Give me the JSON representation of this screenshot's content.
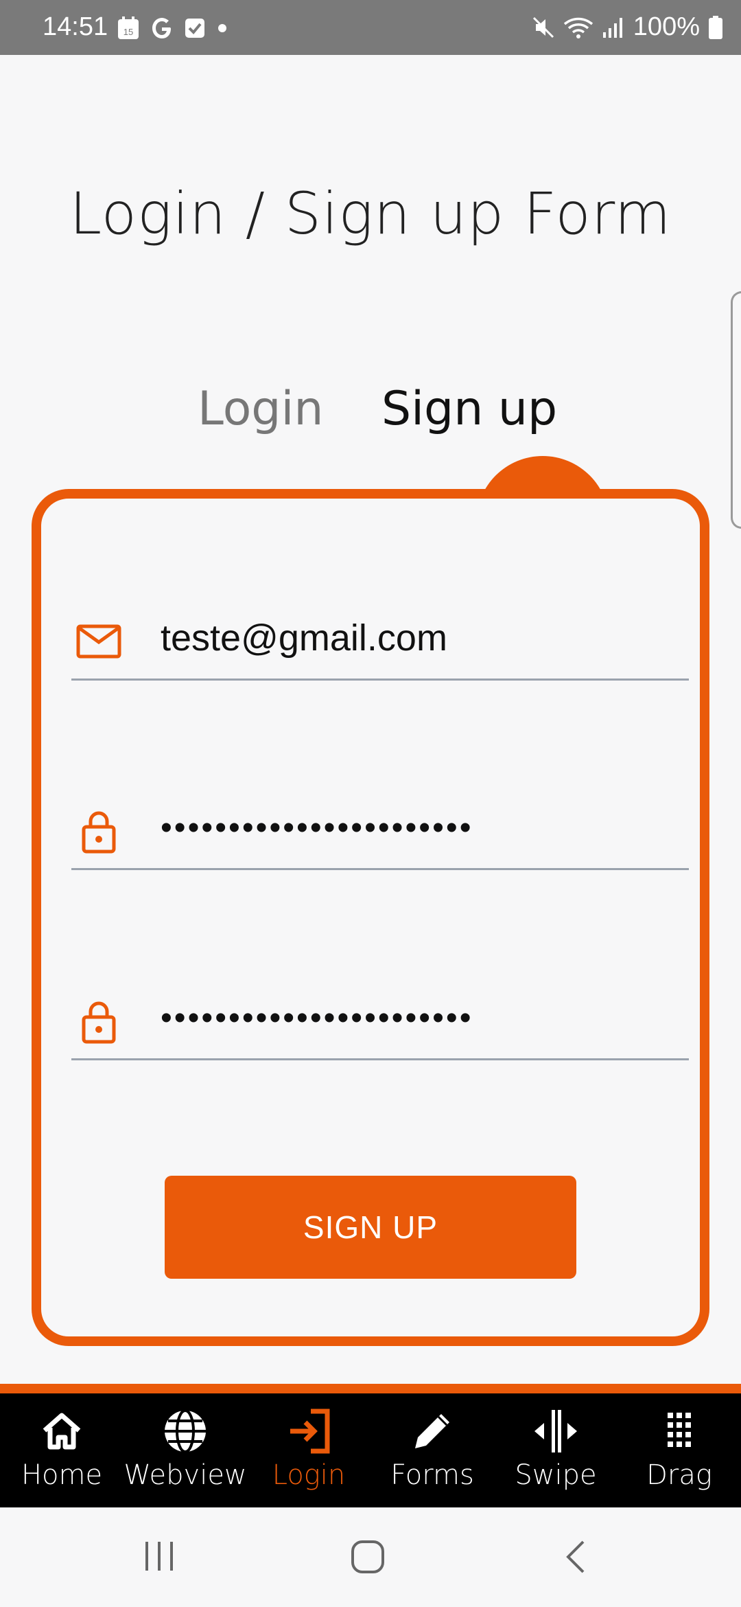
{
  "status_bar": {
    "time": "14:51",
    "calendar_day": "15",
    "battery": "100%"
  },
  "page": {
    "title": "Login / Sign up Form",
    "tabs": [
      {
        "label": "Login",
        "active": false
      },
      {
        "label": "Sign up",
        "active": true
      }
    ]
  },
  "form": {
    "email_value": "teste@gmail.com",
    "password_value": "•••••••••••••••••••••••",
    "confirm_password_value": "•••••••••••••••••••••••",
    "submit_label": "SIGN UP"
  },
  "bottom_nav": {
    "items": [
      {
        "label": "Home",
        "icon": "home-icon"
      },
      {
        "label": "Webview",
        "icon": "globe-icon"
      },
      {
        "label": "Login",
        "icon": "login-icon",
        "active": true
      },
      {
        "label": "Forms",
        "icon": "pencil-icon"
      },
      {
        "label": "Swipe",
        "icon": "swipe-icon"
      },
      {
        "label": "Drag",
        "icon": "drag-grid-icon"
      }
    ]
  },
  "colors": {
    "accent": "#ea5a0a",
    "background": "#f7f7f8",
    "nav_background": "#000000",
    "status_bar": "#7a7a7a"
  }
}
